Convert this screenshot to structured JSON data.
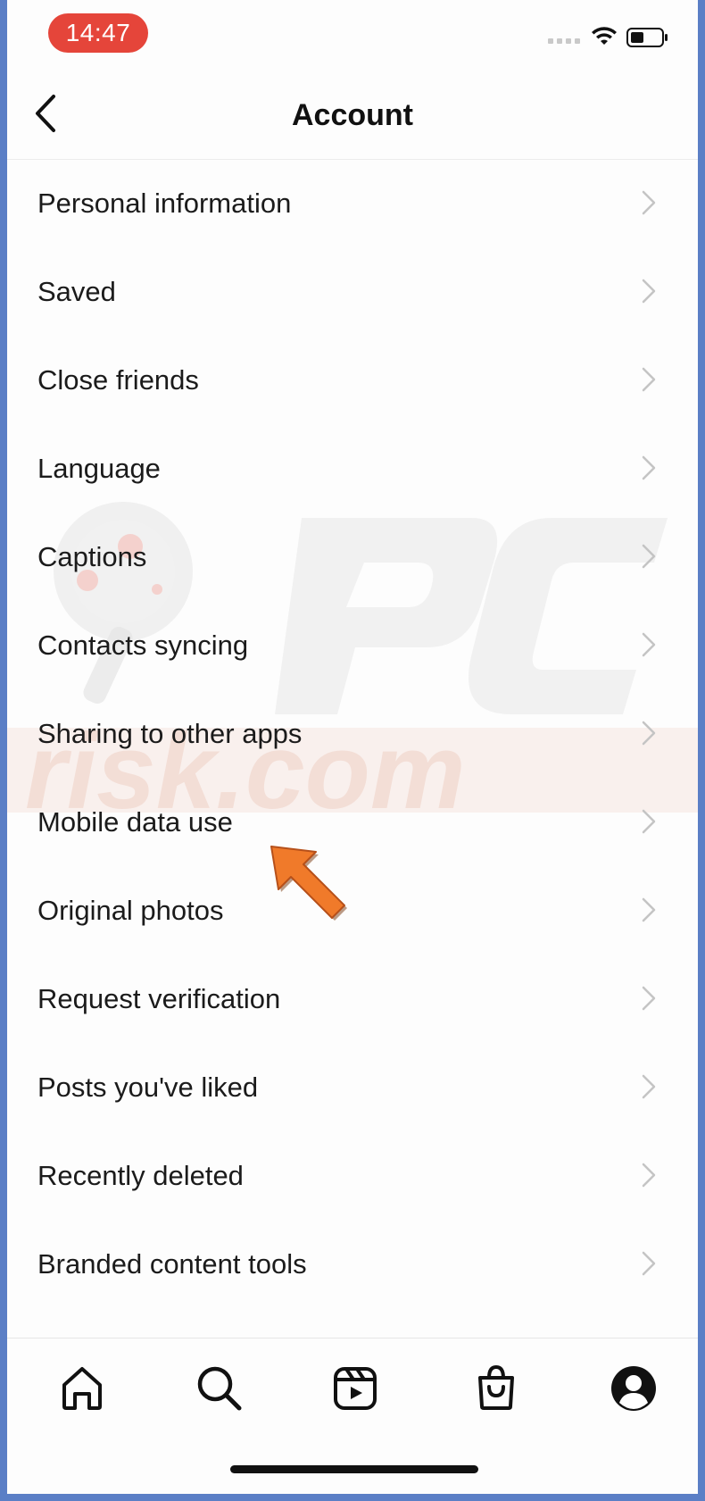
{
  "status_bar": {
    "time": "14:47"
  },
  "header": {
    "title": "Account"
  },
  "menu": [
    {
      "label": "Personal information"
    },
    {
      "label": "Saved"
    },
    {
      "label": "Close friends"
    },
    {
      "label": "Language"
    },
    {
      "label": "Captions"
    },
    {
      "label": "Contacts syncing"
    },
    {
      "label": "Sharing to other apps"
    },
    {
      "label": "Mobile data use"
    },
    {
      "label": "Original photos"
    },
    {
      "label": "Request verification"
    },
    {
      "label": "Posts you've liked"
    },
    {
      "label": "Recently deleted"
    },
    {
      "label": "Branded content tools"
    }
  ],
  "watermark": {
    "text": "PC risk.com"
  },
  "tabbar": {
    "icons": [
      "home-icon",
      "search-icon",
      "reels-icon",
      "shop-icon",
      "profile-icon"
    ]
  },
  "colors": {
    "time_pill": "#e5453a",
    "arrow": "#f07a2a",
    "frame": "#5b7fc6"
  }
}
